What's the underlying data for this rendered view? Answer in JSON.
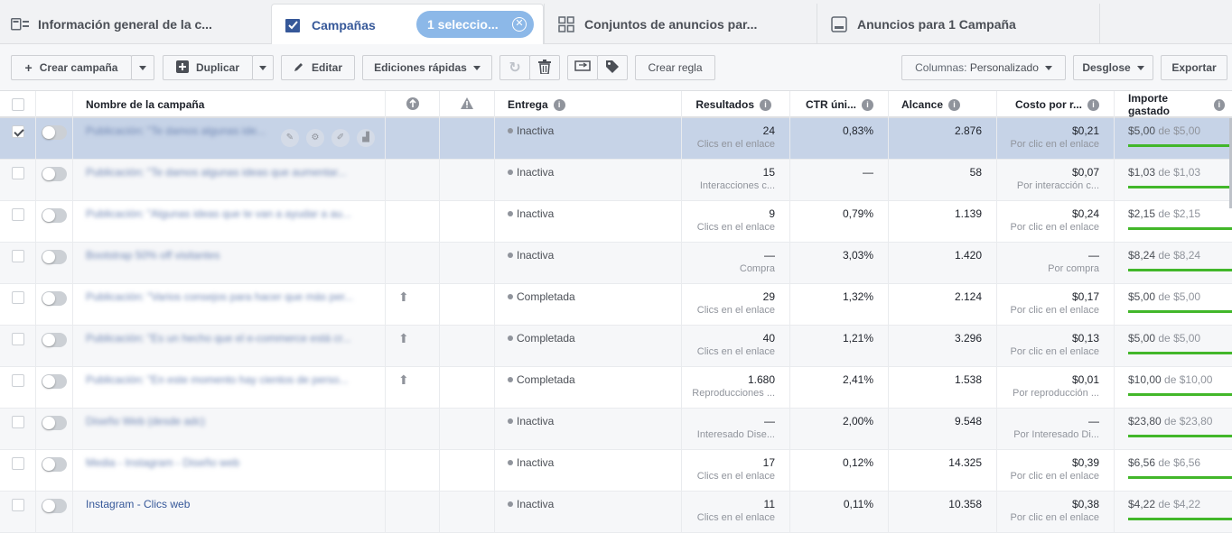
{
  "tabs": [
    {
      "label": "Información general de la c...",
      "icon": "overview-icon"
    },
    {
      "label": "Campañas",
      "icon": "checkbox-icon",
      "active": true
    },
    {
      "label": "Conjuntos de anuncios par...",
      "icon": "grid-icon"
    },
    {
      "label": "Anuncios para 1 Campaña",
      "icon": "ad-icon"
    }
  ],
  "selection_pill": {
    "label": "1 seleccio..."
  },
  "toolbar": {
    "create": "Crear campaña",
    "duplicate": "Duplicar",
    "edit": "Editar",
    "quick_edits": "Ediciones rápidas",
    "create_rule": "Crear regla",
    "columns_label": "Columnas:",
    "columns_value": "Personalizado",
    "breakdown": "Desglose",
    "export": "Exportar"
  },
  "columns": {
    "name": "Nombre de la campaña",
    "delivery": "Entrega",
    "results": "Resultados",
    "ctr": "CTR úni...",
    "reach": "Alcance",
    "cost": "Costo por r...",
    "spent": "Importe gastado"
  },
  "rows": [
    {
      "name": "Publicación: \"Te damos algunas ide...",
      "blur": true,
      "selected": true,
      "delivery": "Inactiva",
      "results": "24",
      "results_sub": "Clics en el enlace",
      "ctr": "0,83%",
      "reach": "2.876",
      "cost": "$0,21",
      "cost_sub": "Por clic en el enlace",
      "spent": "$5,00",
      "budget": "$5,00",
      "budget_fill": 1.0
    },
    {
      "name": "Publicación: \"Te damos algunas ideas que aumentar...",
      "blur": true,
      "delivery": "Inactiva",
      "results": "15",
      "results_sub": "Interacciones c...",
      "ctr": "—",
      "reach": "58",
      "cost": "$0,07",
      "cost_sub": "Por interacción c...",
      "spent": "$1,03",
      "budget": "$1,03",
      "budget_fill": 1.0
    },
    {
      "name": "Publicación: \"Algunas ideas que te van a ayudar a au...",
      "blur": true,
      "delivery": "Inactiva",
      "results": "9",
      "results_sub": "Clics en el enlace",
      "ctr": "0,79%",
      "reach": "1.139",
      "cost": "$0,24",
      "cost_sub": "Por clic en el enlace",
      "spent": "$2,15",
      "budget": "$2,15",
      "budget_fill": 1.0
    },
    {
      "name": "Bootstrap 50% off visitantes",
      "blur": true,
      "delivery": "Inactiva",
      "results": "—",
      "results_sub": "Compra",
      "ctr": "3,03%",
      "reach": "1.420",
      "cost": "—",
      "cost_sub": "Por compra",
      "spent": "$8,24",
      "budget": "$8,24",
      "budget_fill": 1.0
    },
    {
      "name": "Publicación: \"Varios consejos para hacer que más per...",
      "blur": true,
      "up": true,
      "delivery": "Completada",
      "results": "29",
      "results_sub": "Clics en el enlace",
      "ctr": "1,32%",
      "reach": "2.124",
      "cost": "$0,17",
      "cost_sub": "Por clic en el enlace",
      "spent": "$5,00",
      "budget": "$5,00",
      "budget_fill": 1.0
    },
    {
      "name": "Publicación: \"Es un hecho que el e-commerce está cr...",
      "blur": true,
      "up": true,
      "delivery": "Completada",
      "results": "40",
      "results_sub": "Clics en el enlace",
      "ctr": "1,21%",
      "reach": "3.296",
      "cost": "$0,13",
      "cost_sub": "Por clic en el enlace",
      "spent": "$5,00",
      "budget": "$5,00",
      "budget_fill": 1.0
    },
    {
      "name": "Publicación: \"En este momento hay cientos de perso...",
      "blur": true,
      "up": true,
      "delivery": "Completada",
      "results": "1.680",
      "results_sub": "Reproducciones ...",
      "ctr": "2,41%",
      "reach": "1.538",
      "cost": "$0,01",
      "cost_sub": "Por reproducción ...",
      "spent": "$10,00",
      "budget": "$10,00",
      "budget_fill": 1.0
    },
    {
      "name": "Diseño Web (desde adc)",
      "blur": true,
      "delivery": "Inactiva",
      "results": "—",
      "results_sub": "Interesado Dise...",
      "ctr": "2,00%",
      "reach": "9.548",
      "cost": "—",
      "cost_sub": "Por Interesado Di...",
      "spent": "$23,80",
      "budget": "$23,80",
      "budget_fill": 1.0
    },
    {
      "name": "Media - Instagram - Diseño web",
      "blur": true,
      "delivery": "Inactiva",
      "results": "17",
      "results_sub": "Clics en el enlace",
      "ctr": "0,12%",
      "reach": "14.325",
      "cost": "$0,39",
      "cost_sub": "Por clic en el enlace",
      "spent": "$6,56",
      "budget": "$6,56",
      "budget_fill": 1.0
    },
    {
      "name": "Instagram - Clics web",
      "blur": false,
      "delivery": "Inactiva",
      "results": "11",
      "results_sub": "Clics en el enlace",
      "ctr": "0,11%",
      "reach": "10.358",
      "cost": "$0,38",
      "cost_sub": "Por clic en el enlace",
      "spent": "$4,22",
      "budget": "$4,22",
      "budget_fill": 1.0
    }
  ],
  "budget_connector": "de",
  "colors": {
    "accent": "#365899",
    "progress": "#42b72a",
    "selected_row": "#c6d3e7",
    "pill": "#8cb8e8"
  }
}
